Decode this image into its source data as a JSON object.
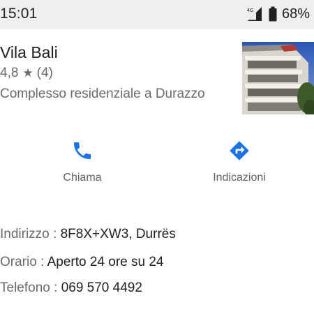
{
  "status_bar": {
    "time": "15:01",
    "network_label": "4G",
    "battery_percent": "68%",
    "icons": [
      "signal-4g-icon",
      "battery-icon"
    ]
  },
  "place": {
    "name": "Vila Bali",
    "rating": "4,8",
    "star": "★",
    "review_count": "(4)",
    "category": "Complesso residenziale a Durazzo",
    "thumbnail": "building-photo"
  },
  "actions": [
    {
      "label": "Chiama",
      "icon": "phone-icon"
    },
    {
      "label": "Indicazioni",
      "icon": "directions-icon"
    }
  ],
  "details": {
    "address": {
      "label": "Indirizzo",
      "sep": " : ",
      "value": "8F8X+XW3, Durrës"
    },
    "hours": {
      "label": "Orario",
      "sep": " : ",
      "value": "Aperto 24 ore su 24"
    },
    "phone": {
      "label": "Telefono",
      "sep": " : ",
      "value": "069 570 4492"
    }
  },
  "colors": {
    "accent_blue": "#1a73e8",
    "status_bar_bg": "#efefef",
    "secondary_text": "#6a6a6a"
  }
}
